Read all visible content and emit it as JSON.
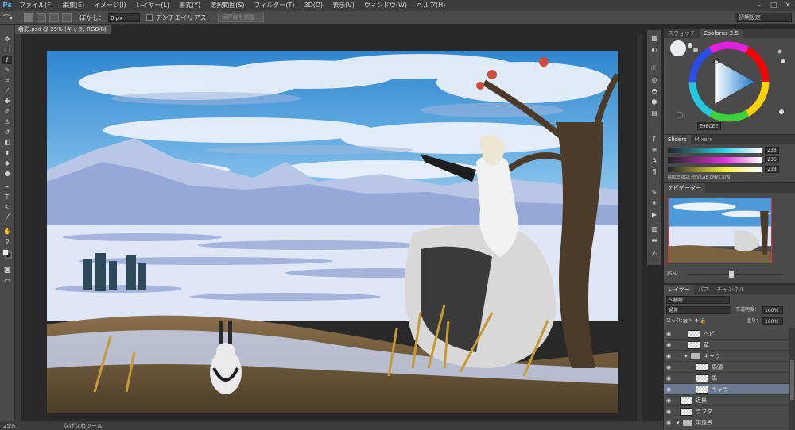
{
  "app": {
    "logo": "Ps"
  },
  "menu": [
    "ファイル(F)",
    "編集(E)",
    "イメージ(I)",
    "レイヤー(L)",
    "書式(Y)",
    "選択範囲(S)",
    "フィルター(T)",
    "3D(D)",
    "表示(V)",
    "ウィンドウ(W)",
    "ヘルプ(H)"
  ],
  "window_controls": {
    "minimize": "–",
    "maximize": "□",
    "close": "✕"
  },
  "options": {
    "feather_label": "ぼかし：",
    "feather_value": "0 px",
    "antialias_label": "アンチエイリアス",
    "refine_edge_label": "境界線を調整...",
    "workspace": "初期設定"
  },
  "document": {
    "tab_title": "着彩.psd @ 25% (キャラ, RGB/8)",
    "close": "×"
  },
  "status": {
    "zoom": "25%",
    "tool_name": "なげなわツール"
  },
  "swatches_panel": {
    "tabs": [
      "スウォッチ",
      "Coolorus 2.5"
    ],
    "active_tab": 1,
    "hex": "E9ECEE",
    "slider_tabs": [
      "Sliders",
      "Mixers"
    ],
    "sliders": [
      {
        "value": "233",
        "color": "#27d0e8"
      },
      {
        "value": "236",
        "color": "#e02fe0"
      },
      {
        "value": "238",
        "color": "#f0f03a"
      }
    ],
    "modes": "MODE RGB HSV LAB CMYK B/W"
  },
  "navigator": {
    "tab": "ナビゲーター",
    "zoom": "25%"
  },
  "layers": {
    "tabs": [
      "レイヤー",
      "パス",
      "チャンネル"
    ],
    "filter_label": "ρ 種類",
    "blend_mode": "通常",
    "opacity_label": "不透明度：",
    "opacity": "100%",
    "lock_label": "ロック：",
    "fill_label": "塗り：",
    "fill": "100%",
    "items": [
      {
        "name": "ヘビ",
        "indent": 1,
        "type": "layer"
      },
      {
        "name": "草",
        "indent": 1,
        "type": "layer"
      },
      {
        "name": "キャラ",
        "indent": 1,
        "type": "folder"
      },
      {
        "name": "馬頭",
        "indent": 2,
        "type": "layer"
      },
      {
        "name": "馬",
        "indent": 2,
        "type": "layer"
      },
      {
        "name": "キャラ",
        "indent": 2,
        "type": "layer",
        "selected": true
      },
      {
        "name": "近景",
        "indent": 0,
        "type": "layer"
      },
      {
        "name": "ラフダ",
        "indent": 0,
        "type": "layer"
      },
      {
        "name": "中遠景",
        "indent": 0,
        "type": "folder"
      }
    ]
  }
}
